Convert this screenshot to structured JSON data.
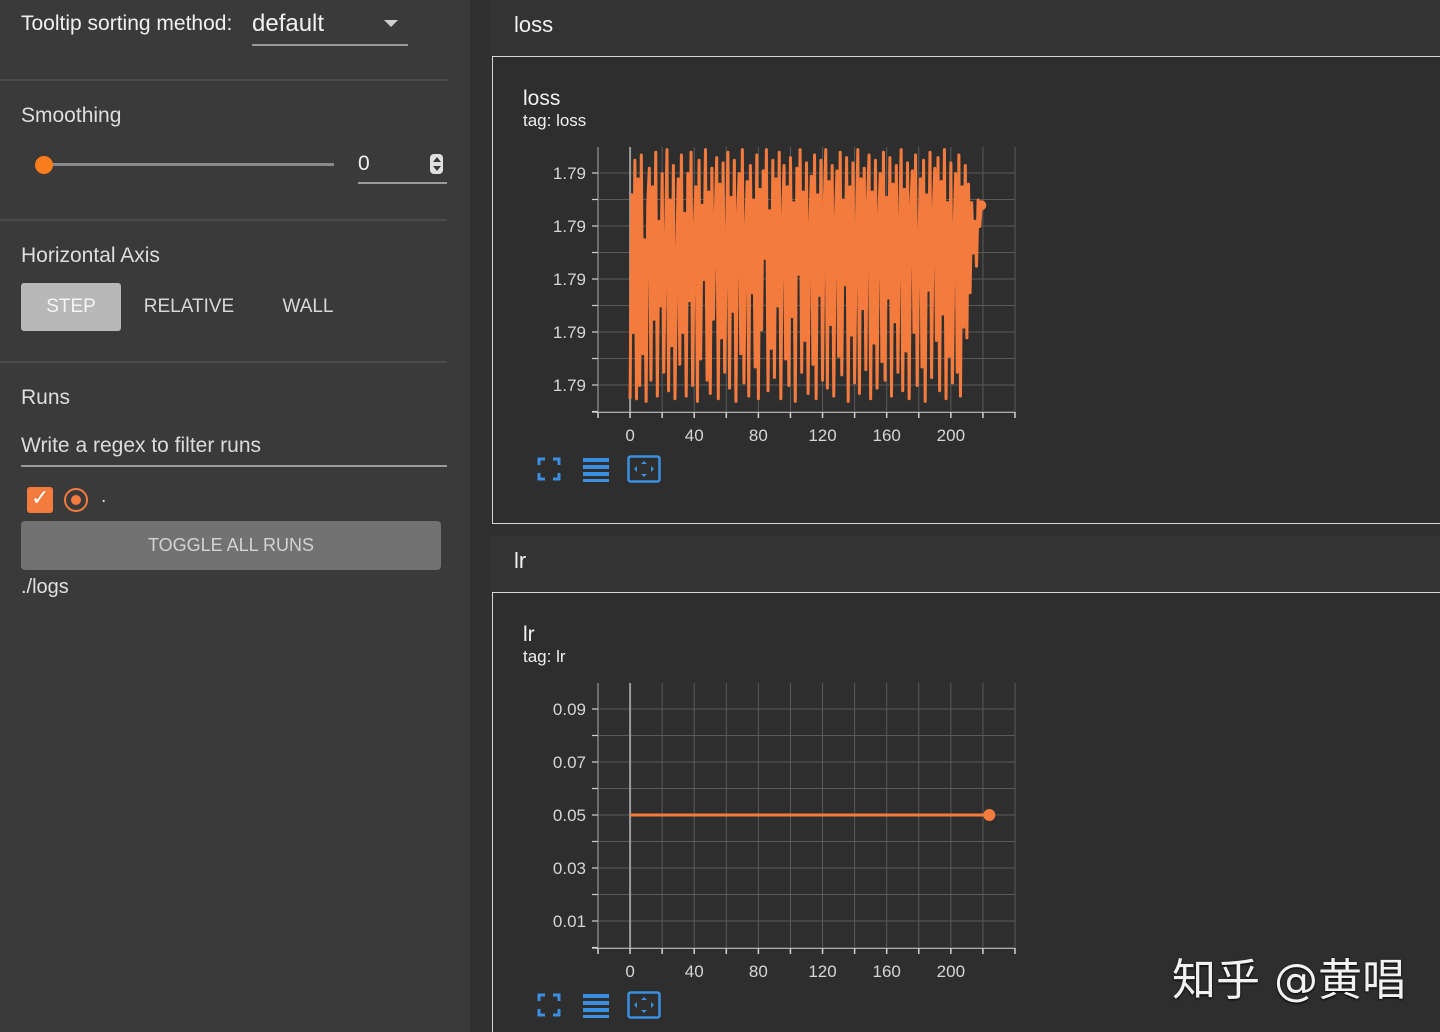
{
  "sidebar": {
    "tooltip_label": "Tooltip sorting method:",
    "tooltip_value": "default",
    "smoothing_title": "Smoothing",
    "smoothing_value": "0",
    "smoothing_fraction": 0,
    "horizontal_axis_title": "Horizontal Axis",
    "axis_buttons": [
      "STEP",
      "RELATIVE",
      "WALL"
    ],
    "axis_selected": "STEP",
    "runs_title": "Runs",
    "runs_filter_placeholder": "Write a regex to filter runs",
    "run_name": ".",
    "run_checked": true,
    "toggle_label": "TOGGLE ALL RUNS",
    "logdir": "./logs"
  },
  "groups": [
    {
      "title": "loss",
      "card_title": "loss",
      "tag": "tag: loss"
    },
    {
      "title": "lr",
      "card_title": "lr",
      "tag": "tag: lr"
    }
  ],
  "watermark": "知乎 @黄唱",
  "colors": {
    "series": "#f47b3e",
    "accent": "#f97d1c",
    "tool_icon": "#3b8fe0"
  },
  "chart_data": [
    {
      "type": "line",
      "title": "loss",
      "x_ticks": [
        "0",
        "40",
        "80",
        "120",
        "160",
        "200"
      ],
      "y_ticks": [
        "1.79",
        "1.79",
        "1.79",
        "1.79",
        "1.79"
      ],
      "xlim": [
        -20,
        240
      ],
      "x_range": [
        0,
        219
      ],
      "series": [
        {
          "values": [
            0.05,
            0.82,
            0.3,
            0.95,
            0.05,
            0.88,
            0.1,
            0.97,
            0.22,
            0.65,
            0.04,
            0.78,
            0.92,
            0.12,
            0.85,
            0.35,
            0.98,
            0.06,
            0.72,
            0.4,
            0.9,
            0.15,
            0.6,
            0.99,
            0.08,
            0.8,
            0.25,
            0.93,
            0.05,
            0.55,
            0.88,
            0.18,
            0.97,
            0.3,
            0.75,
            0.06,
            0.9,
            0.42,
            0.98,
            0.1,
            0.68,
            0.85,
            0.04,
            0.95,
            0.2,
            0.78,
            0.5,
            0.99,
            0.12,
            0.83,
            0.07,
            0.92,
            0.35,
            0.7,
            0.96,
            0.05,
            0.86,
            0.28,
            0.94,
            0.15,
            0.62,
            0.98,
            0.09,
            0.81,
            0.38,
            0.95,
            0.04,
            0.74,
            0.9,
            0.22,
            0.99,
            0.11,
            0.67,
            0.87,
            0.06,
            0.93,
            0.45,
            0.8,
            0.17,
            0.97,
            0.05,
            0.84,
            0.31,
            0.91,
            0.58,
            0.99,
            0.08,
            0.76,
            0.24,
            0.95,
            0.13,
            0.88,
            0.4,
            0.98,
            0.05,
            0.71,
            0.93,
            0.2,
            0.85,
            0.1,
            0.96,
            0.36,
            0.79,
            0.04,
            0.92,
            0.52,
            0.99,
            0.15,
            0.83,
            0.27,
            0.94,
            0.07,
            0.69,
            0.89,
            0.18,
            0.97,
            0.05,
            0.82,
            0.44,
            0.95,
            0.12,
            0.76,
            0.99,
            0.09,
            0.87,
            0.33,
            0.93,
            0.06,
            0.72,
            0.91,
            0.21,
            0.98,
            0.14,
            0.8,
            0.48,
            0.96,
            0.04,
            0.85,
            0.29,
            0.94,
            0.11,
            0.66,
            0.99,
            0.07,
            0.88,
            0.39,
            0.92,
            0.16,
            0.78,
            0.97,
            0.05,
            0.83,
            0.26,
            0.95,
            0.09,
            0.73,
            0.9,
            0.19,
            0.98,
            0.12,
            0.81,
            0.43,
            0.96,
            0.06,
            0.86,
            0.34,
            0.93,
            0.15,
            0.7,
            0.99,
            0.08,
            0.84,
            0.23,
            0.94,
            0.05,
            0.77,
            0.91,
            0.3,
            0.97,
            0.1,
            0.64,
            0.88,
            0.17,
            0.95,
            0.04,
            0.82,
            0.46,
            0.98,
            0.13,
            0.75,
            0.92,
            0.27,
            0.96,
            0.08,
            0.87,
            0.37,
            0.99,
            0.05,
            0.79,
            0.21,
            0.94,
            0.11,
            0.68,
            0.9,
            0.15,
            0.97,
            0.06,
            0.85,
            0.32,
            0.93,
            0.28,
            0.86,
            0.45,
            0.79,
            0.6,
            0.72,
            0.55,
            0.8,
            0.7,
            0.78
          ]
        }
      ]
    },
    {
      "type": "line",
      "title": "lr",
      "x_ticks": [
        "0",
        "40",
        "80",
        "120",
        "160",
        "200"
      ],
      "y_ticks": [
        "0.09",
        "0.07",
        "0.05",
        "0.03",
        "0.01"
      ],
      "xlim": [
        -20,
        240
      ],
      "ylim": [
        0,
        0.1
      ],
      "series": [
        {
          "x": [
            0,
            224
          ],
          "values": [
            0.05,
            0.05
          ]
        }
      ]
    }
  ]
}
